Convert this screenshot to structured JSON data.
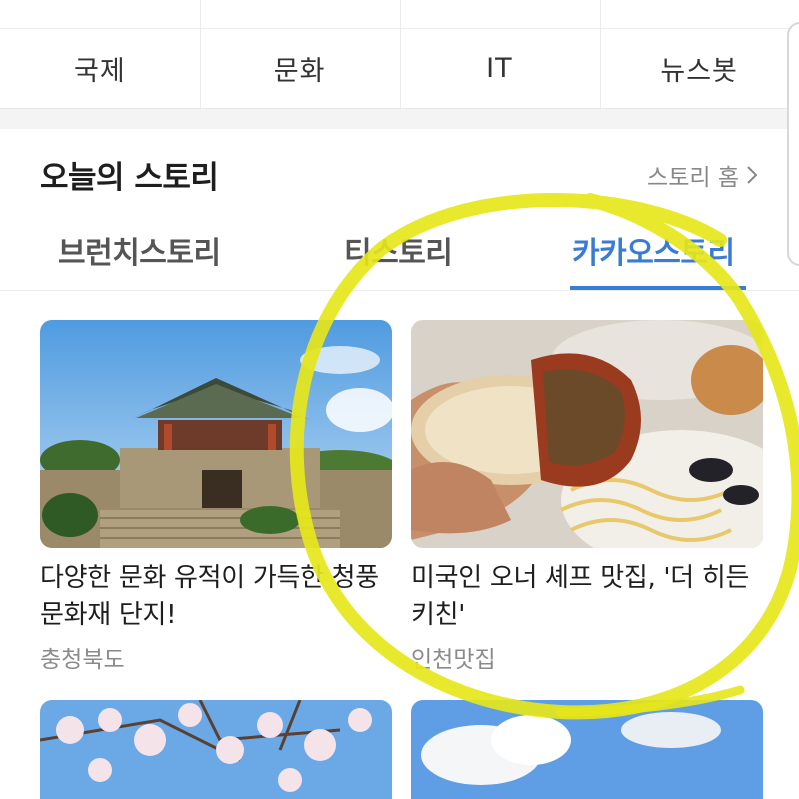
{
  "categories": [
    "국제",
    "문화",
    "IT",
    "뉴스봇"
  ],
  "section": {
    "title": "오늘의 스토리",
    "home_link": "스토리 홈"
  },
  "tabs": [
    {
      "label": "브런치스토리",
      "active": false
    },
    {
      "label": "티스토리",
      "active": false
    },
    {
      "label": "카카오스토리",
      "active": true
    }
  ],
  "cards": [
    {
      "title": "다양한 문화 유적이 가득한 청풍 문화재 단지!",
      "category": "충청북도",
      "icon": "pavilion-photo"
    },
    {
      "title": "미국인 오너 셰프 맛집, '더 히든 키친'",
      "category": "인천맛집",
      "icon": "food-photo"
    },
    {
      "title": "",
      "category": "",
      "icon": "cherry-blossom-photo"
    },
    {
      "title": "",
      "category": "",
      "icon": "sky-clouds-photo"
    }
  ],
  "colors": {
    "accent": "#3a7bd5",
    "annotation": "#e6e61a"
  }
}
